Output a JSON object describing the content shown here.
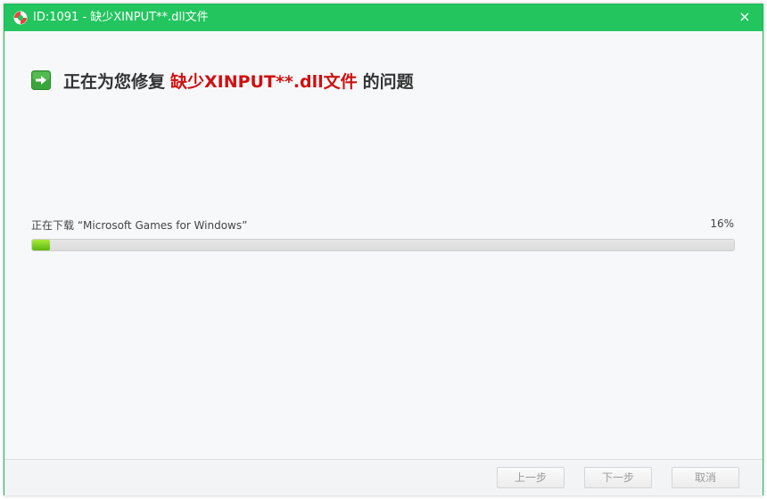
{
  "window": {
    "title": "ID:1091 - 缺少XINPUT**.dll文件",
    "close_glyph": "×",
    "titlebar_color": "#22c55e"
  },
  "heading": {
    "prefix": "正在为您修复",
    "highlight": "缺少XINPUT**.dll文件",
    "suffix": "的问题",
    "highlight_color": "#d01010",
    "icon": "green-arrow-right-icon"
  },
  "progress": {
    "status": "正在下载 “Microsoft Games for Windows”",
    "percent_label": "16%",
    "value": 0.025
  },
  "footer": {
    "prev_label": "上一步",
    "next_label": "下一步",
    "cancel_label": "取消"
  }
}
